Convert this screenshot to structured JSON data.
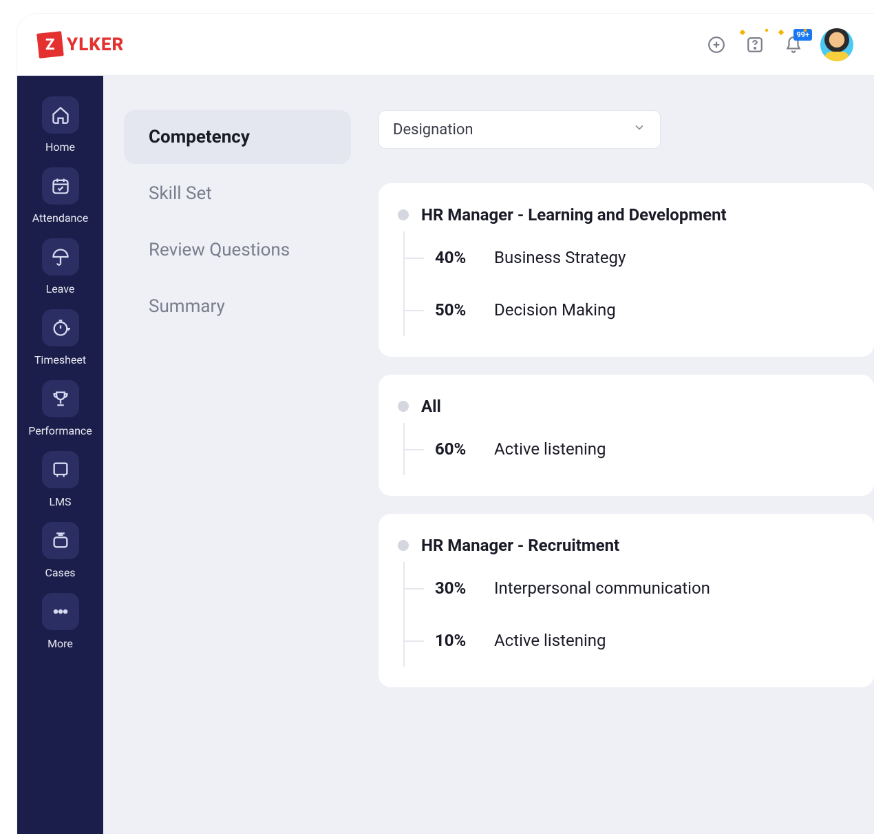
{
  "brand": {
    "letter": "Z",
    "name": "YLKER"
  },
  "topbar": {
    "notif_badge": "99+"
  },
  "sidebar": {
    "items": [
      {
        "label": "Home"
      },
      {
        "label": "Attendance"
      },
      {
        "label": "Leave"
      },
      {
        "label": "Timesheet"
      },
      {
        "label": "Performance"
      },
      {
        "label": "LMS"
      },
      {
        "label": "Cases"
      },
      {
        "label": "More"
      }
    ]
  },
  "tabs": [
    {
      "label": "Competency"
    },
    {
      "label": "Skill Set"
    },
    {
      "label": "Review Questions"
    },
    {
      "label": "Summary"
    }
  ],
  "filter": {
    "label": "Designation"
  },
  "groups": [
    {
      "title": "HR Manager - Learning and Development",
      "items": [
        {
          "pct": "40%",
          "skill": "Business Strategy"
        },
        {
          "pct": "50%",
          "skill": "Decision Making"
        }
      ]
    },
    {
      "title": "All",
      "items": [
        {
          "pct": "60%",
          "skill": "Active listening"
        }
      ]
    },
    {
      "title": "HR Manager - Recruitment",
      "items": [
        {
          "pct": "30%",
          "skill": "Interpersonal communication"
        },
        {
          "pct": "10%",
          "skill": "Active listening"
        }
      ]
    }
  ]
}
